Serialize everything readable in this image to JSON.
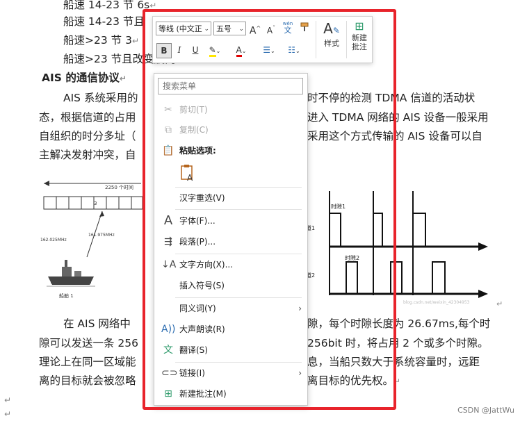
{
  "document": {
    "lines": [
      "船速 14-23 节  6s",
      "船速 14-23 节且",
      "船速>23 节  3",
      "船速>23 节且改变航向 2s"
    ],
    "heading": "AIS 的通信协议",
    "para1": [
      "AIS 系统采用的",
      "时不停的检测 TDMA 信道的活动状",
      "态，根据信道的占用",
      "进入 TDMA 网络的 AIS 设备一般采用",
      "自组织的时分多址（",
      "采用这个方式传输的 AIS 设备可以自",
      "主解决发射冲突，自"
    ],
    "para2": [
      "在 AIS 网络中",
      "隙，每个时隙长度为 26.67ms,每个时",
      "隙可以发送一条 256",
      "256bit 时，将占用 2 个或多个时隙。",
      "理论上在同一区域能",
      "息，当船只数大于系统容量时，远距",
      "离的目标就会被忽略",
      "离目标的优先权。"
    ],
    "figure_left": {
      "label_top": "2250 个时间",
      "slot_label": "3",
      "freq1": "162.025MHz",
      "freq2": "161.975MHz",
      "ship_label": "船舶 1"
    },
    "figure_right": {
      "slot1": "时隙1",
      "slot2": "时隙2",
      "channel1": "道1",
      "channel2": "道2",
      "url": "blog.csdn.net/weixin_42304953"
    },
    "watermark": "CSDN @JattWu"
  },
  "toolbar": {
    "font_name": "等线 (中文正",
    "font_size": "五号",
    "grow_font": "A",
    "shrink_font": "A",
    "phonetic_top": "wén",
    "phonetic_bottom": "文",
    "bold": "B",
    "italic": "I",
    "underline": "U",
    "font_color": "A",
    "styles_label": "样式",
    "new_comment_label_1": "新建",
    "new_comment_label_2": "批注"
  },
  "context_menu": {
    "search_placeholder": "搜索菜单",
    "items": {
      "cut": "剪切(T)",
      "copy": "复制(C)",
      "paste_options": "粘贴选项:",
      "reconvert": "汉字重选(V)",
      "font": "字体(F)...",
      "paragraph": "段落(P)...",
      "text_direction": "文字方向(X)...",
      "insert_symbol": "插入符号(S)",
      "synonyms": "同义词(Y)",
      "read_aloud": "大声朗读(R)",
      "translate": "翻译(S)",
      "link": "链接(I)",
      "new_comment": "新建批注(M)"
    }
  },
  "colors": {
    "highlight_frame": "#e8232b",
    "highlight_yellow": "#ffe600",
    "font_color_red": "#e00000",
    "accent_green": "#2e9a6b"
  }
}
